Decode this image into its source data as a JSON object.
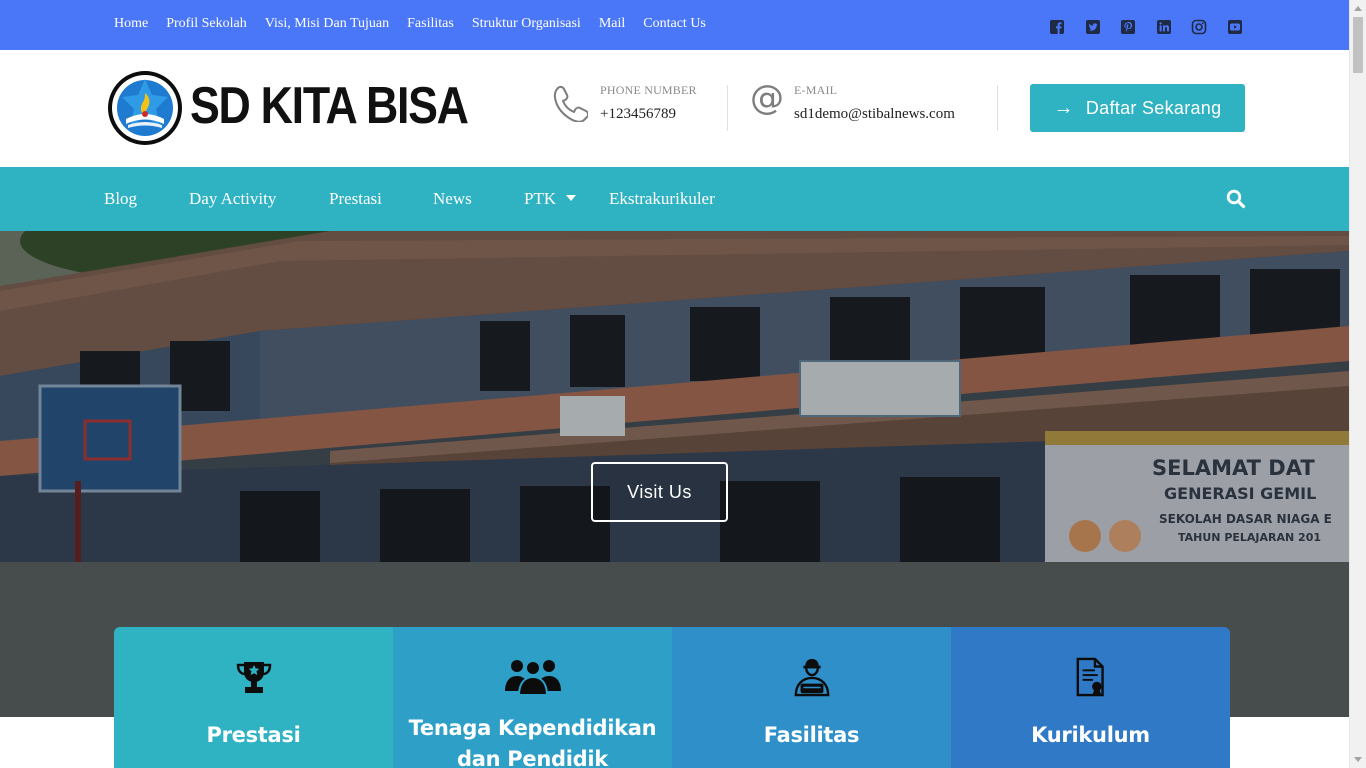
{
  "topbar": {
    "links": [
      "Home",
      "Profil Sekolah",
      "Visi, Misi Dan Tujuan",
      "Fasilitas",
      "Struktur Organisasi",
      "Mail",
      "Contact Us"
    ],
    "social_icons": [
      "facebook-icon",
      "twitter-icon",
      "pinterest-icon",
      "linkedin-icon",
      "instagram-icon",
      "youtube-icon"
    ],
    "color": "#4a77f7"
  },
  "header": {
    "logo_text": "SD KITA BISA",
    "phone_label": "PHONE NUMBER",
    "phone_value": "+123456789",
    "email_label": "E-MAIL",
    "email_value": "sd1demo@stibalnews.com",
    "cta_label": "Daftar Sekarang",
    "cta_color": "#2fb3c3"
  },
  "mainnav": {
    "items": [
      "Blog",
      "Day Activity",
      "Prestasi",
      "News",
      "PTK",
      "Ekstrakurikuler"
    ],
    "color": "#2fb3c3"
  },
  "hero": {
    "button_label": "Visit Us"
  },
  "features": [
    {
      "title": "Prestasi",
      "icon": "trophy-icon",
      "color": "#2fb3c3"
    },
    {
      "title_line1": "Tenaga Kependidikan",
      "title_line2": "dan Pendidik",
      "icon": "group-icon",
      "color": "#2ea0c8"
    },
    {
      "title": "Fasilitas",
      "icon": "worker-icon",
      "color": "#2f90c9"
    },
    {
      "title": "Kurikulum",
      "icon": "certificate-icon",
      "color": "#2f79c6"
    }
  ]
}
